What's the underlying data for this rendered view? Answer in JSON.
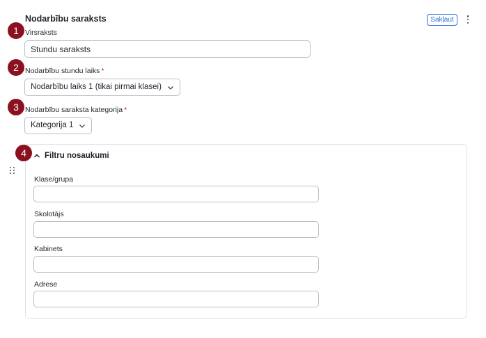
{
  "header": {
    "title": "Nodarbību saraksts",
    "collapse_label": "Sakļaut",
    "more_icon": "vertical-ellipsis-icon"
  },
  "badges": [
    "1",
    "2",
    "3",
    "4"
  ],
  "fields": {
    "heading": {
      "label": "Virsraksts",
      "value": "Stundu saraksts"
    },
    "lesson_time": {
      "label": "Nodarbību stundu laiks",
      "required_mark": "*",
      "value": "Nodarbību laiks 1 (tikai pirmai klasei)"
    },
    "category": {
      "label": "Nodarbību saraksta kategorija",
      "required_mark": "*",
      "value": "Kategorija 1"
    }
  },
  "filters": {
    "title": "Filtru nosaukumi",
    "expanded": true,
    "items": [
      {
        "label": "Klase/grupa",
        "value": ""
      },
      {
        "label": "Skolotājs",
        "value": ""
      },
      {
        "label": "Kabinets",
        "value": ""
      },
      {
        "label": "Adrese",
        "value": ""
      }
    ]
  },
  "colors": {
    "accent": "#2f6fd6",
    "badge": "#8b1121",
    "required": "#c5202d"
  }
}
